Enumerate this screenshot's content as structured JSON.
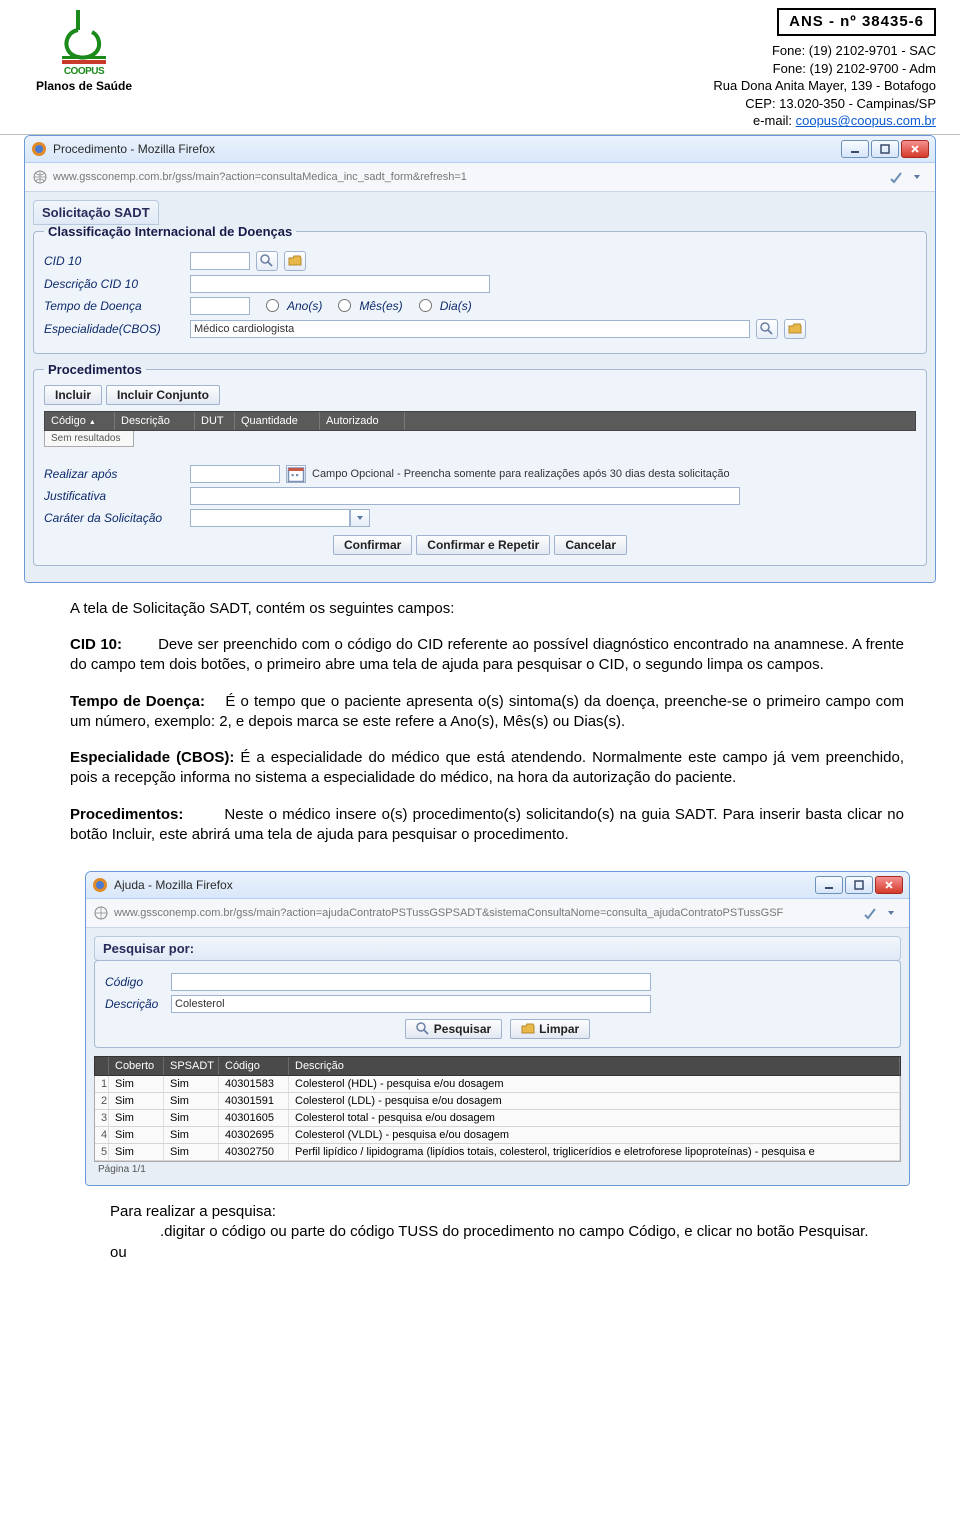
{
  "header": {
    "ans_number": "ANS - nº 38435-6",
    "phone_sac": "Fone: (19) 2102-9701 - SAC",
    "phone_adm": "Fone: (19) 2102-9700 - Adm",
    "address": "Rua Dona Anita Mayer, 139 - Botafogo",
    "cep": "CEP: 13.020-350 - Campinas/SP",
    "email_label": "e-mail: ",
    "email_value": "coopus@coopus.com.br",
    "logo_title": "COOPUS",
    "planos": "Planos de Saúde"
  },
  "window1": {
    "title": "Procedimento - Mozilla Firefox",
    "url": "www.gssconemp.com.br/gss/main?action=consultaMedica_inc_sadt_form&refresh=1",
    "panel_title": "Solicitação SADT",
    "fs1_legend": "Classificação Internacional de Doenças",
    "lbl_cid10": "CID 10",
    "lbl_desc_cid10": "Descrição CID 10",
    "lbl_tempo": "Tempo de Doença",
    "radio_anos": "Ano(s)",
    "radio_meses": "Mês(es)",
    "radio_dias": "Dia(s)",
    "lbl_espec": "Especialidade(CBOS)",
    "espec_value": "Médico cardiologista",
    "fs2_legend": "Procedimentos",
    "btn_incluir": "Incluir",
    "btn_incluir_conj": "Incluir Conjunto",
    "th_codigo": "Código",
    "th_desc": "Descrição",
    "th_dut": "DUT",
    "th_qtd": "Quantidade",
    "th_aut": "Autorizado",
    "empty_results": "Sem resultados",
    "lbl_realizar": "Realizar após",
    "realizar_hint": "Campo Opcional - Preencha somente para realizações após 30 dias desta solicitação",
    "lbl_just": "Justificativa",
    "lbl_carater": "Caráter da Solicitação",
    "btn_confirmar": "Confirmar",
    "btn_conf_rep": "Confirmar e Repetir",
    "btn_cancelar": "Cancelar"
  },
  "body_text": {
    "intro": "A tela de Solicitação SADT, contém os seguintes campos:",
    "cid10_label": "CID 10:",
    "cid10_text": "Deve ser preenchido com o código do CID referente ao possível diagnóstico encontrado na anamnese. A frente do campo tem dois botões, o primeiro abre uma tela de ajuda para pesquisar o CID, o segundo limpa os campos.",
    "tempo_label": "Tempo de Doença:",
    "tempo_text": "É o tempo que o paciente apresenta o(s) sintoma(s) da doença, preenche-se o primeiro campo com um número, exemplo: 2, e depois marca se este refere a Ano(s), Mês(s) ou Dias(s).",
    "espec_label": "Especialidade (CBOS):",
    "espec_text": "É a especialidade do médico que está atendendo. Normalmente este campo já vem preenchido, pois a recepção informa no sistema a especialidade do médico, na hora da autorização do paciente.",
    "proc_label": "Procedimentos:",
    "proc_text": "Neste o médico insere o(s) procedimento(s) solicitando(s) na guia SADT. Para inserir basta clicar no botão Incluir, este abrirá uma tela de ajuda para pesquisar o procedimento."
  },
  "window2": {
    "title": "Ajuda - Mozilla Firefox",
    "url": "www.gssconemp.com.br/gss/main?action=ajudaContratoPSTussGSPSADT&sistemaConsultaNome=consulta_ajudaContratoPSTussGSF",
    "panel_title": "Pesquisar por:",
    "lbl_codigo": "Código",
    "lbl_desc": "Descrição",
    "desc_value": "Colesterol",
    "btn_pesq": "Pesquisar",
    "btn_limpar": "Limpar",
    "th_coberto": "Coberto",
    "th_spsadt": "SPSADT",
    "th_codigo": "Código",
    "th_desc": "Descrição",
    "page": "Página 1/1",
    "rows": [
      {
        "idx": "1",
        "cob": "Sim",
        "sps": "Sim",
        "cod": "40301583",
        "desc": "Colesterol (HDL) - pesquisa e/ou dosagem"
      },
      {
        "idx": "2",
        "cob": "Sim",
        "sps": "Sim",
        "cod": "40301591",
        "desc": "Colesterol (LDL) - pesquisa e/ou dosagem"
      },
      {
        "idx": "3",
        "cob": "Sim",
        "sps": "Sim",
        "cod": "40301605",
        "desc": "Colesterol total - pesquisa e/ou dosagem"
      },
      {
        "idx": "4",
        "cob": "Sim",
        "sps": "Sim",
        "cod": "40302695",
        "desc": "Colesterol (VLDL) - pesquisa e/ou dosagem"
      },
      {
        "idx": "5",
        "cob": "Sim",
        "sps": "Sim",
        "cod": "40302750",
        "desc": "Perfil lipídico / lipidograma (lipídios totais, colesterol, triglicerídios e eletroforese lipoproteínas) - pesquisa e"
      }
    ]
  },
  "footer": {
    "para_realizar": "Para realizar a pesquisa:",
    "digitar": ".digitar o código ou parte do código TUSS do procedimento no campo Código, e clicar no botão Pesquisar.",
    "ou": "ou"
  }
}
